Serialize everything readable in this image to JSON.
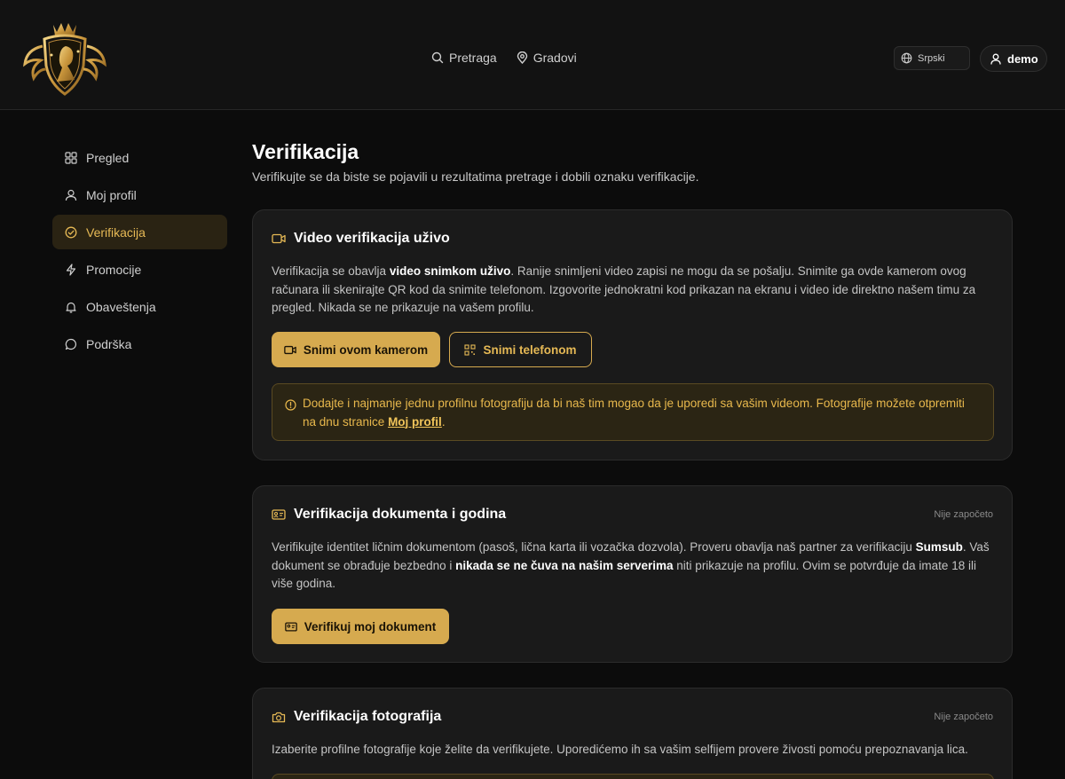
{
  "header": {
    "nav": [
      {
        "label": "Pretraga",
        "icon": "search-icon"
      },
      {
        "label": "Gradovi",
        "icon": "map-pin-icon"
      }
    ],
    "language": "Srpski",
    "user": "demo"
  },
  "sidebar": {
    "items": [
      {
        "label": "Pregled",
        "icon": "grid-icon"
      },
      {
        "label": "Moj profil",
        "icon": "user-icon"
      },
      {
        "label": "Verifikacija",
        "icon": "check-circle-icon",
        "active": true
      },
      {
        "label": "Promocije",
        "icon": "bolt-icon"
      },
      {
        "label": "Obaveštenja",
        "icon": "bell-icon"
      },
      {
        "label": "Podrška",
        "icon": "chat-icon"
      }
    ]
  },
  "page": {
    "title": "Verifikacija",
    "subtitle": "Verifikujte se da biste se pojavili u rezultatima pretrage i dobili oznaku verifikacije."
  },
  "video_card": {
    "title": "Video verifikacija uživo",
    "text_1": "Verifikacija se obavlja ",
    "text_bold": "video snimkom uživo",
    "text_2": ". Ranije snimljeni video zapisi ne mogu da se pošalju. Snimite ga ovde kamerom ovog računara ili skenirajte QR kod da snimite telefonom. Izgovorite jednokratni kod prikazan na ekranu i video ide direktno našem timu za pregled. Nikada se ne prikazuje na vašem profilu.",
    "btn_camera": "Snimi ovom kamerom",
    "btn_phone": "Snimi telefonom",
    "alert_text": "Dodajte i najmanje jednu profilnu fotografiju da bi naš tim mogao da je uporedi sa vašim videom. Fotografije možete otpremiti na dnu stranice ",
    "alert_link": "Moj profil",
    "alert_end": "."
  },
  "document_card": {
    "title": "Verifikacija dokumenta i godina",
    "status": "Nije započeto",
    "text_1": "Verifikujte identitet ličnim dokumentom (pasoš, lična karta ili vozačka dozvola). Proveru obavlja naš partner za verifikaciju ",
    "text_bold_1": "Sumsub",
    "text_2": ". Vaš dokument se obrađuje bezbedno i ",
    "text_bold_2": "nikada se ne čuva na našim serverima",
    "text_3": " niti prikazuje na profilu. Ovim se potvrđuje da imate 18 ili više godina.",
    "button": "Verifikuj moj dokument"
  },
  "photo_card": {
    "title": "Verifikacija fotografija",
    "status": "Nije započeto",
    "text": "Izaberite profilne fotografije koje želite da verifikujete. Uporedićemo ih sa vašim selfijem provere živosti pomoću prepoznavanja lica."
  },
  "colors": {
    "accent": "#d6aa4f",
    "accent_text": "#e6b955",
    "background": "#0c0c0c",
    "card": "#1a1a1a"
  }
}
